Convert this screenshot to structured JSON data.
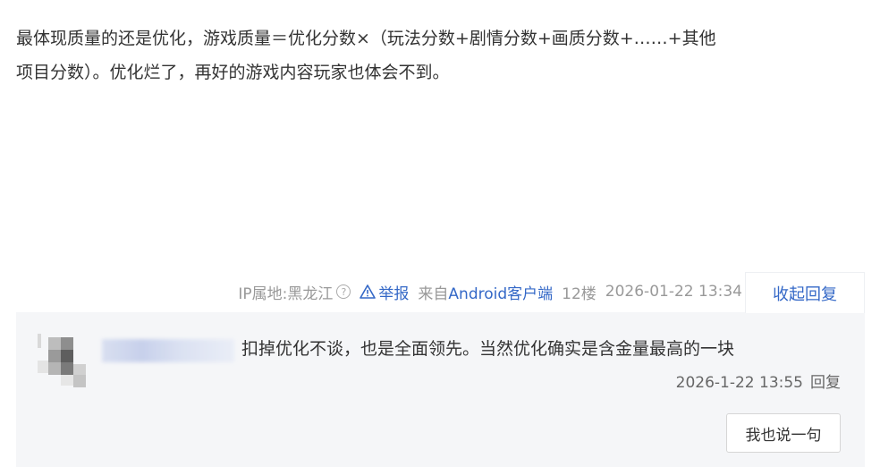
{
  "post": {
    "line1": "最体现质量的还是优化，游戏质量＝优化分数×（玩法分数+剧情分数+画质分数+……+其他",
    "line2": "项目分数）。优化烂了，再好的游戏内容玩家也体会不到。"
  },
  "meta": {
    "ip": "IP属地:黑龙江",
    "help_icon": "?",
    "report": "举报",
    "from_prefix": "来自",
    "from_client": "Android客户端",
    "floor": "12楼",
    "datetime": "2026-01-22 13:34"
  },
  "collapse_label": "收起回复",
  "reply": {
    "text": "扣掉优化不谈，也是全面领先。当然优化确实是含金量最高的一块",
    "datetime": "2026-1-22 13:55",
    "reply_label": "回复"
  },
  "say_button": "我也说一句",
  "colors": {
    "link": "#3468c7",
    "panel_bg": "#f5f6f8",
    "meta_text": "#999999"
  }
}
